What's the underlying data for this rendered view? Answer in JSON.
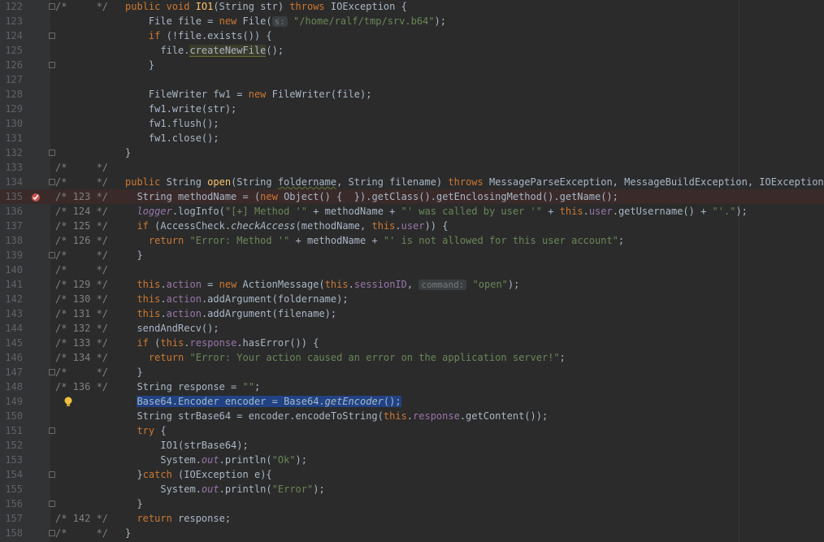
{
  "editor": {
    "lines": [
      {
        "n": "122",
        "c": "/*     */",
        "t": [
          [
            "kw",
            "public void "
          ],
          [
            "fn",
            "IO1"
          ],
          [
            "",
            "(String str) "
          ],
          [
            "kw",
            "throws "
          ],
          [
            "",
            "IOException {"
          ]
        ]
      },
      {
        "n": "123",
        "c": "",
        "t": [
          [
            "",
            "    File file = "
          ],
          [
            "kw",
            "new "
          ],
          [
            "",
            "File("
          ],
          [
            "hint",
            "s:"
          ],
          [
            "",
            " "
          ],
          [
            "str",
            "\"/home/ralf/tmp/srv.b64\""
          ],
          [
            "",
            ");"
          ]
        ]
      },
      {
        "n": "124",
        "c": "",
        "t": [
          [
            "",
            "    "
          ],
          [
            "kw",
            "if "
          ],
          [
            "",
            "(!file.exists()) {"
          ]
        ]
      },
      {
        "n": "125",
        "c": "",
        "t": [
          [
            "",
            "      file."
          ],
          [
            "hl",
            "createNewFile"
          ],
          [
            "",
            "();"
          ]
        ]
      },
      {
        "n": "126",
        "c": "",
        "t": [
          [
            "",
            "    }"
          ]
        ]
      },
      {
        "n": "127",
        "c": "",
        "t": []
      },
      {
        "n": "128",
        "c": "",
        "t": [
          [
            "",
            "    FileWriter fw1 = "
          ],
          [
            "kw",
            "new "
          ],
          [
            "",
            "FileWriter(file);"
          ]
        ]
      },
      {
        "n": "129",
        "c": "",
        "t": [
          [
            "",
            "    fw1.write(str);"
          ]
        ]
      },
      {
        "n": "130",
        "c": "",
        "t": [
          [
            "",
            "    fw1.flush();"
          ]
        ]
      },
      {
        "n": "131",
        "c": "",
        "t": [
          [
            "",
            "    fw1.close();"
          ]
        ]
      },
      {
        "n": "132",
        "c": "",
        "t": [
          [
            "",
            "}"
          ]
        ]
      },
      {
        "n": "133",
        "c": "/*     */",
        "t": []
      },
      {
        "n": "134",
        "c": "/*     */",
        "t": [
          [
            "kw",
            "public "
          ],
          [
            "",
            "String "
          ],
          [
            "fn",
            "open"
          ],
          [
            "",
            "(String "
          ],
          [
            "squig",
            "foldername"
          ],
          [
            "",
            ", String filename) "
          ],
          [
            "kw",
            "throws "
          ],
          [
            "",
            "MessageParseException, MessageBuildException, IOException {"
          ]
        ]
      },
      {
        "n": "135",
        "c": "/* 123 */",
        "t": [
          [
            "",
            "  String methodName = ("
          ],
          [
            "kw",
            "new "
          ],
          [
            "",
            "Object() {  }).getClass().getEnclosingMethod().getName();"
          ]
        ],
        "err": true
      },
      {
        "n": "136",
        "c": "/* 124 */",
        "t": [
          [
            "",
            "  "
          ],
          [
            "fld it",
            "logger"
          ],
          [
            "",
            ".logInfo("
          ],
          [
            "str",
            "\"[+] Method '\""
          ],
          [
            "",
            " + methodName + "
          ],
          [
            "str",
            "\"' was called by user '\""
          ],
          [
            "",
            " + "
          ],
          [
            "kw",
            "this"
          ],
          [
            "",
            "."
          ],
          [
            "fld",
            "user"
          ],
          [
            "",
            ".getUsername() + "
          ],
          [
            "str",
            "\"'.\""
          ],
          [
            "",
            ");"
          ]
        ]
      },
      {
        "n": "137",
        "c": "/* 125 */",
        "t": [
          [
            "",
            "  "
          ],
          [
            "kw",
            "if "
          ],
          [
            "",
            "(AccessCheck."
          ],
          [
            "it",
            "checkAccess"
          ],
          [
            "",
            "(methodName, "
          ],
          [
            "kw",
            "this"
          ],
          [
            "",
            "."
          ],
          [
            "fld",
            "user"
          ],
          [
            "",
            ")) {"
          ]
        ]
      },
      {
        "n": "138",
        "c": "/* 126 */",
        "t": [
          [
            "",
            "    "
          ],
          [
            "kw",
            "return "
          ],
          [
            "str",
            "\"Error: Method '\""
          ],
          [
            "",
            " + methodName + "
          ],
          [
            "str",
            "\"' is not allowed for this user account\""
          ],
          [
            "",
            ";"
          ]
        ]
      },
      {
        "n": "139",
        "c": "/*     */",
        "t": [
          [
            "",
            "  }"
          ]
        ]
      },
      {
        "n": "140",
        "c": "/*     */",
        "t": []
      },
      {
        "n": "141",
        "c": "/* 129 */",
        "t": [
          [
            "",
            "  "
          ],
          [
            "kw",
            "this"
          ],
          [
            "",
            "."
          ],
          [
            "fld",
            "action"
          ],
          [
            "",
            " = "
          ],
          [
            "kw",
            "new "
          ],
          [
            "",
            "ActionMessage("
          ],
          [
            "kw",
            "this"
          ],
          [
            "",
            "."
          ],
          [
            "fld",
            "sessionID"
          ],
          [
            "",
            ", "
          ],
          [
            "hint",
            "command:"
          ],
          [
            "",
            " "
          ],
          [
            "str",
            "\"open\""
          ],
          [
            "",
            ");"
          ]
        ]
      },
      {
        "n": "142",
        "c": "/* 130 */",
        "t": [
          [
            "",
            "  "
          ],
          [
            "kw",
            "this"
          ],
          [
            "",
            "."
          ],
          [
            "fld",
            "action"
          ],
          [
            "",
            ".addArgument(foldername);"
          ]
        ]
      },
      {
        "n": "143",
        "c": "/* 131 */",
        "t": [
          [
            "",
            "  "
          ],
          [
            "kw",
            "this"
          ],
          [
            "",
            "."
          ],
          [
            "fld",
            "action"
          ],
          [
            "",
            ".addArgument(filename);"
          ]
        ]
      },
      {
        "n": "144",
        "c": "/* 132 */",
        "t": [
          [
            "",
            "  sendAndRecv();"
          ]
        ]
      },
      {
        "n": "145",
        "c": "/* 133 */",
        "t": [
          [
            "",
            "  "
          ],
          [
            "kw",
            "if "
          ],
          [
            "",
            "("
          ],
          [
            "kw",
            "this"
          ],
          [
            "",
            "."
          ],
          [
            "fld",
            "response"
          ],
          [
            "",
            ".hasError()) {"
          ]
        ]
      },
      {
        "n": "146",
        "c": "/* 134 */",
        "t": [
          [
            "",
            "    "
          ],
          [
            "kw",
            "return "
          ],
          [
            "str",
            "\"Error: Your action caused an error on the application server!\""
          ],
          [
            "",
            ";"
          ]
        ]
      },
      {
        "n": "147",
        "c": "/*     */",
        "t": [
          [
            "",
            "  }"
          ]
        ]
      },
      {
        "n": "148",
        "c": "/* 136 */",
        "t": [
          [
            "",
            "  String response = "
          ],
          [
            "str",
            "\"\""
          ],
          [
            "",
            ";"
          ]
        ]
      },
      {
        "n": "149",
        "c": "",
        "t": [
          [
            "",
            "  "
          ],
          [
            "sel",
            "Base64.Encoder encoder = Base64."
          ],
          [
            "sel it",
            "getEncoder"
          ],
          [
            "sel",
            "();"
          ]
        ],
        "bulb": true
      },
      {
        "n": "150",
        "c": "",
        "t": [
          [
            "",
            "  String strBase64 = encoder.encodeToString("
          ],
          [
            "kw",
            "this"
          ],
          [
            "",
            "."
          ],
          [
            "fld",
            "response"
          ],
          [
            "",
            ".getContent());"
          ]
        ]
      },
      {
        "n": "151",
        "c": "",
        "t": [
          [
            "",
            "  "
          ],
          [
            "kw",
            "try "
          ],
          [
            "",
            "{"
          ]
        ]
      },
      {
        "n": "152",
        "c": "",
        "t": [
          [
            "",
            "      IO1(strBase64);"
          ]
        ]
      },
      {
        "n": "153",
        "c": "",
        "t": [
          [
            "",
            "      System."
          ],
          [
            "fld it",
            "out"
          ],
          [
            "",
            ".println("
          ],
          [
            "str",
            "\"Ok\""
          ],
          [
            "",
            ");"
          ]
        ]
      },
      {
        "n": "154",
        "c": "",
        "t": [
          [
            "",
            "  }"
          ],
          [
            "kw",
            "catch "
          ],
          [
            "",
            "(IOException e){"
          ]
        ]
      },
      {
        "n": "155",
        "c": "",
        "t": [
          [
            "",
            "      System."
          ],
          [
            "fld it",
            "out"
          ],
          [
            "",
            ".println("
          ],
          [
            "str",
            "\"Error\""
          ],
          [
            "",
            ");"
          ]
        ]
      },
      {
        "n": "156",
        "c": "",
        "t": [
          [
            "",
            "  }"
          ]
        ]
      },
      {
        "n": "157",
        "c": "/* 142 */",
        "t": [
          [
            "",
            "  "
          ],
          [
            "kw",
            "return "
          ],
          [
            "",
            "response;"
          ]
        ]
      },
      {
        "n": "158",
        "c": "/*     */",
        "t": [
          [
            "",
            "}"
          ]
        ]
      }
    ]
  },
  "colors": {
    "background": "#2b2b2b",
    "gutter": "#313335",
    "keyword": "#cc7832",
    "string": "#6a8759",
    "field": "#9876aa",
    "function": "#ffc66d",
    "selection": "#214283"
  },
  "icons": {
    "breakpoint": "breakpoint-error-icon",
    "bulb": "lightbulb-icon"
  }
}
